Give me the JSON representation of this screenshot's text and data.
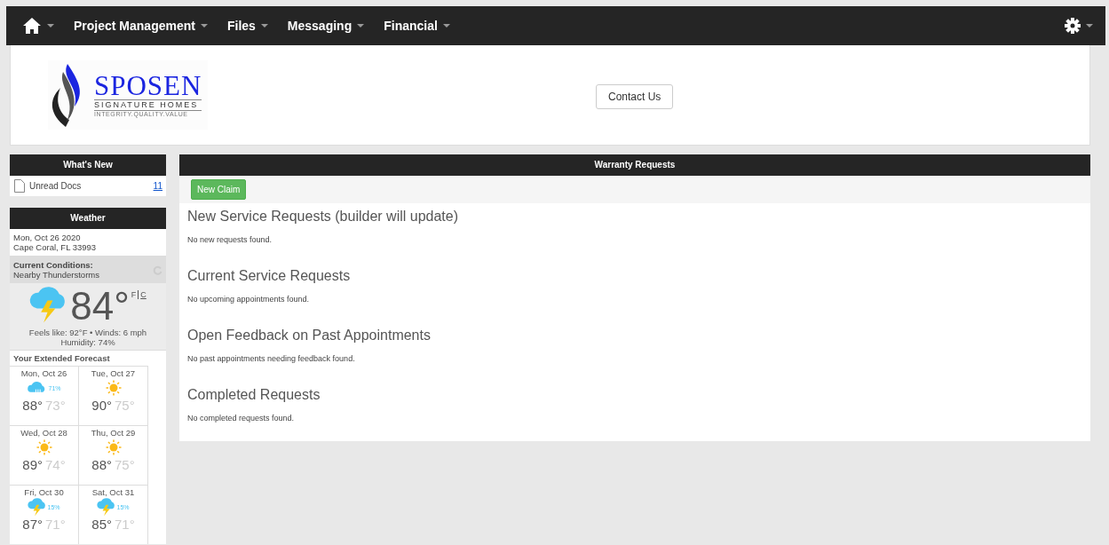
{
  "nav": {
    "items": [
      {
        "label": "Project Management"
      },
      {
        "label": "Files"
      },
      {
        "label": "Messaging"
      },
      {
        "label": "Financial"
      }
    ]
  },
  "header": {
    "logo": {
      "name": "SPOSEN",
      "subtitle": "SIGNATURE HOMES",
      "tagline": "INTEGRITY.QUALITY.VALUE"
    },
    "contact_button": "Contact Us"
  },
  "whats_new": {
    "title": "What's New",
    "items": [
      {
        "label": "Unread Docs",
        "count": "11"
      }
    ]
  },
  "weather": {
    "title": "Weather",
    "date": "Mon, Oct 26 2020",
    "location": "Cape Coral, FL 33993",
    "conditions_label": "Current Conditions:",
    "conditions": "Nearby Thunderstorms",
    "kind": "storm",
    "temperature": "84°",
    "units": [
      {
        "label": "F",
        "selected": true
      },
      {
        "label": "C",
        "selected": false
      }
    ],
    "details": "Feels like: 92°F • Winds: 6 mph",
    "humidity": "Humidity: 74%",
    "forecast_title": "Your Extended Forecast",
    "forecast": [
      {
        "day": "Mon, Oct 26",
        "kind": "rain",
        "precip": "71%",
        "high": "88°",
        "low": "73°"
      },
      {
        "day": "Tue, Oct 27",
        "kind": "sun",
        "high": "90°",
        "low": "75°"
      },
      {
        "day": "Wed, Oct 28",
        "kind": "sun",
        "high": "89°",
        "low": "74°"
      },
      {
        "day": "Thu, Oct 29",
        "kind": "sun",
        "high": "88°",
        "low": "75°"
      },
      {
        "day": "Fri, Oct 30",
        "kind": "storm",
        "precip": "15%",
        "high": "87°",
        "low": "71°"
      },
      {
        "day": "Sat, Oct 31",
        "kind": "storm",
        "precip": "15%",
        "high": "85°",
        "low": "71°"
      }
    ]
  },
  "warranty": {
    "title": "Warranty Requests",
    "new_button": "New Claim",
    "sections": [
      {
        "heading": "New Service Requests (builder will update)",
        "message": "No new requests found."
      },
      {
        "heading": "Current Service Requests",
        "message": "No upcoming appointments found."
      },
      {
        "heading": "Open Feedback on Past Appointments",
        "message": "No past appointments needing feedback found."
      },
      {
        "heading": "Completed Requests",
        "message": "No completed requests found."
      }
    ]
  }
}
